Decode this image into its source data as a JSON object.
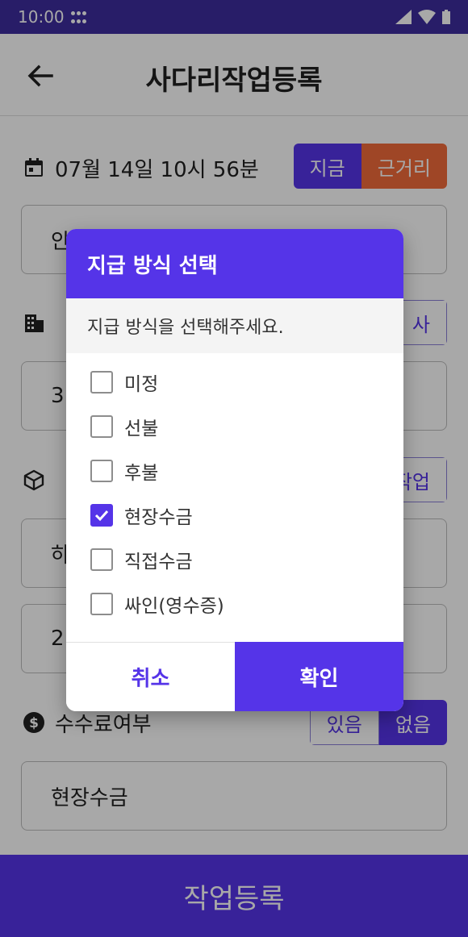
{
  "status": {
    "time": "10:00"
  },
  "appbar": {
    "title": "사다리작업등록"
  },
  "date": {
    "text": "07월 14일 10시 56분"
  },
  "pay_seg": {
    "now": "지금",
    "near": "근거리"
  },
  "fields": {
    "f1": "안",
    "f2": "3",
    "f3": "하",
    "f4": "2",
    "fee": "현장수금"
  },
  "side_buttons": {
    "b1": "사",
    "b2": "작업"
  },
  "fee_row": {
    "label": "수수료여부",
    "yes": "있음",
    "no": "없음"
  },
  "bottom": {
    "submit": "작업등록"
  },
  "dialog": {
    "title": "지급 방식 선택",
    "subtitle": "지급 방식을 선택해주세요.",
    "options": [
      {
        "label": "미정",
        "checked": false
      },
      {
        "label": "선불",
        "checked": false
      },
      {
        "label": "후불",
        "checked": false
      },
      {
        "label": "현장수금",
        "checked": true
      },
      {
        "label": "직접수금",
        "checked": false
      },
      {
        "label": "싸인(영수증)",
        "checked": false
      }
    ],
    "cancel": "취소",
    "confirm": "확인"
  },
  "colors": {
    "primary": "#5534e8",
    "orange": "#f26b3a",
    "status": "#3d2c9e"
  }
}
